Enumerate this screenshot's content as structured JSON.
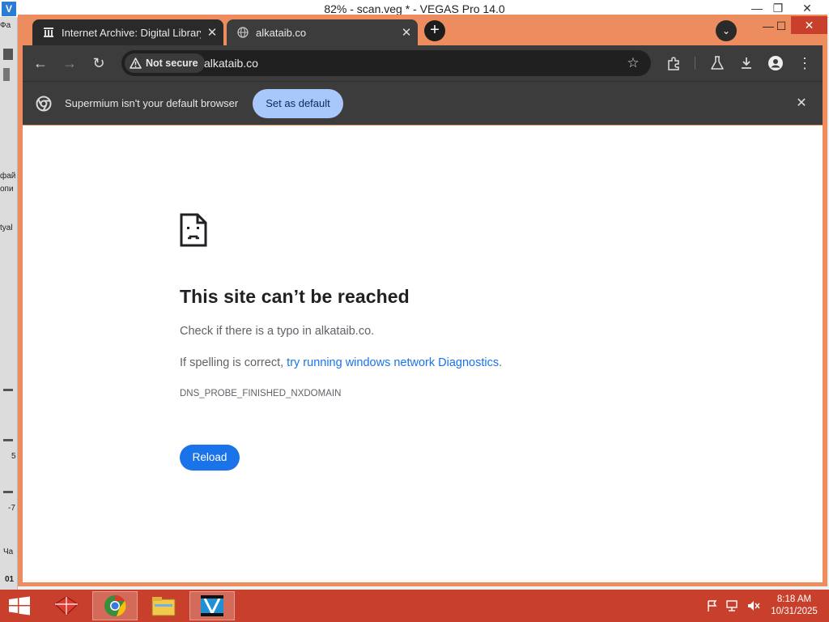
{
  "vegas": {
    "title": "82% - scan.veg * - VEGAS Pro 14.0",
    "logo_glyph": "V",
    "controls": {
      "minimize": "—",
      "restore": "❐",
      "close": "✕"
    },
    "side_labels": [
      "Фа",
      "фай",
      "опи",
      "tyal",
      "5",
      "-7",
      "Ча",
      "01"
    ]
  },
  "browser": {
    "tabs": [
      {
        "title": "Internet Archive: Digital Library",
        "icon": "archive-icon",
        "close": "✕"
      },
      {
        "title": "alkataib.co",
        "icon": "globe-icon",
        "close": "✕"
      }
    ],
    "new_tab_glyph": "+",
    "tab_search_glyph": "⌄",
    "window_controls": {
      "minimize": "—",
      "maximize": "☐",
      "close": "✕"
    },
    "toolbar": {
      "back_glyph": "←",
      "forward_glyph": "→",
      "reload_glyph": "↻",
      "security_chip": "Not secure",
      "url": "alkataib.co",
      "star_glyph": "☆",
      "menu_glyph": "⋮"
    },
    "infobar": {
      "message": "Supermium isn't your default browser",
      "button": "Set as default",
      "close": "✕"
    },
    "error_page": {
      "title": "This site can’t be reached",
      "typo_line": "Check if there is a typo in alkataib.co.",
      "diag_prefix": "If spelling is correct, ",
      "diag_link": "try running windows network Diagnostics",
      "diag_suffix": ".",
      "error_code": "DNS_PROBE_FINISHED_NXDOMAIN",
      "reload": "Reload"
    },
    "colors": {
      "frame": "#ed8c5e",
      "toolbar": "#3c3c3c",
      "link": "#1a73e8",
      "button": "#1a73e8",
      "infobar_button": "#a8c7fa"
    }
  },
  "taskbar": {
    "clock": {
      "time": "8:18 AM",
      "date": "10/31/2025"
    },
    "apps": [
      "app-red-icon",
      "chrome-icon",
      "file-explorer-icon",
      "vegas-icon"
    ],
    "color": "#c8402b"
  }
}
